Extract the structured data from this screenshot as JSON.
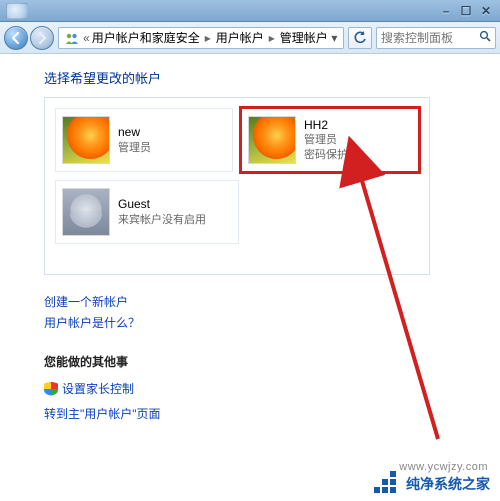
{
  "breadcrumb": {
    "seg0_icon": "user-accounts-icon",
    "seg0": "用户帐户和家庭安全",
    "seg1": "用户帐户",
    "seg2": "管理帐户"
  },
  "search": {
    "placeholder": "搜索控制面板"
  },
  "heading": "选择希望更改的帐户",
  "accounts": {
    "new": {
      "name": "new",
      "role": "管理员",
      "extra": ""
    },
    "hh2": {
      "name": "HH2",
      "role": "管理员",
      "extra": "密码保护"
    },
    "guest": {
      "name": "Guest",
      "role": "来宾帐户没有启用",
      "extra": ""
    }
  },
  "links": {
    "create": "创建一个新帐户",
    "whatis": "用户帐户是什么？"
  },
  "other": {
    "label": "您能做的其他事",
    "parental": "设置家长控制",
    "goto_main": "转到主\"用户帐户\"页面"
  },
  "watermark": {
    "text": "纯净系统之家",
    "url": "www.ycwjzy.com"
  }
}
